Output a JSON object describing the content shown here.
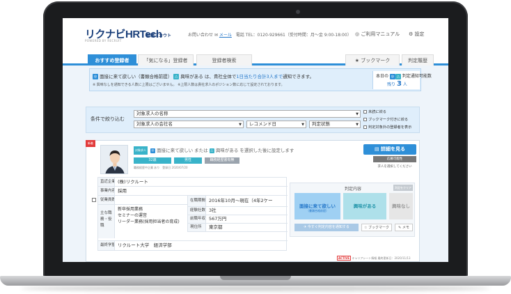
{
  "header": {
    "logo": "リクナビHRTech",
    "logo_suffix": "転職スカウト",
    "logo_sub": "POWERED BY RECRUIT",
    "contact_label": "お問い合わせ",
    "mail_label": "メール",
    "phone": "電話 TEL：0120-929661（受付時間：月〜金 9:00-18:00）",
    "manual": "ご利用マニュアル",
    "settings": "設定"
  },
  "tabs": [
    {
      "label": "おすすめ登録者"
    },
    {
      "label": "「気になる」登録者"
    },
    {
      "label": "登録者検索"
    },
    {
      "label": "ブックマーク"
    },
    {
      "label": "判定履歴"
    }
  ],
  "notice": {
    "line1_a": "面接に来て欲しい（書類合格前提）",
    "line1_b": "興味がある",
    "line1_c": "は、貴社全体で",
    "line1_hl": "1日当たり合計3人まで",
    "line1_d": "通知できます。",
    "line2": "※ 興味なしを通知できる人数に上限はございません。 ※上限人数は貴社求人のポジション数に応じて設定されております。",
    "today_label": "本日の",
    "today_suffix": "判定通知可能数",
    "remaining_label": "残り",
    "remaining_count": "3",
    "remaining_unit": "人"
  },
  "filter": {
    "label": "条件で絞り込む",
    "job_name": "対象求人の名称",
    "company_name": "対象求人の会社名",
    "recommend_date": "レコメンド日",
    "judge_state": "判定状態",
    "checks": [
      "未読に絞る",
      "ブックマーク付きに絞る",
      "判定対象外の登録者を表示"
    ]
  },
  "card": {
    "ribbon": "新着",
    "tag": "対象求人",
    "hint_a": "面接に来て欲しい または",
    "hint_b": "興味がある",
    "hint_c": "を選択した後に設定します",
    "detail_button": "詳細を見る",
    "age": "32歳",
    "gender": "男性",
    "flag": "職務経歴書有無",
    "meta": "職務経歴中企業 あり　登録日 2020/07/20",
    "apply_badge": "応募可能性",
    "apply_note": "求人を選択してください",
    "rows": [
      {
        "label": "直近企業",
        "value": "(株)リクルート"
      },
      {
        "label": "事業内容",
        "value": "採用"
      },
      {
        "label": "従業員数",
        "value": ""
      },
      {
        "label": "主な職務・役職",
        "value": "新卒採用業務\nセミナーの運営\nリーダー業務(採用担当者の育成)"
      },
      {
        "label": "最終学歴",
        "value": "リクルート大学　経済学部"
      }
    ],
    "right_rows": [
      {
        "label": "在職期間",
        "value": "2016年10月〜現在（4年2ケー"
      },
      {
        "label": "経験社数",
        "value": "3社"
      },
      {
        "label": "前職年収",
        "value": "567万円"
      },
      {
        "label": "現住所",
        "value": "東京都"
      }
    ],
    "judge_title": "判定内容",
    "judge_small": "判定をクリア",
    "judge1": "面接に来て欲しい",
    "judge1_sub": "（書類合格前提）",
    "judge2": "興味がある",
    "judge3": "興味なし",
    "send_button": "今すぐ判定内容を通知する",
    "bookmark": "ブックマーク",
    "memo": "メモ",
    "active": "ACTIVE",
    "active_note": "キャリアシート情報 最終更新日：2020/11/13"
  },
  "colors": {
    "accent": "#2e8fd8",
    "teal": "#39b3c9",
    "ribbon": "#e23b3b"
  }
}
